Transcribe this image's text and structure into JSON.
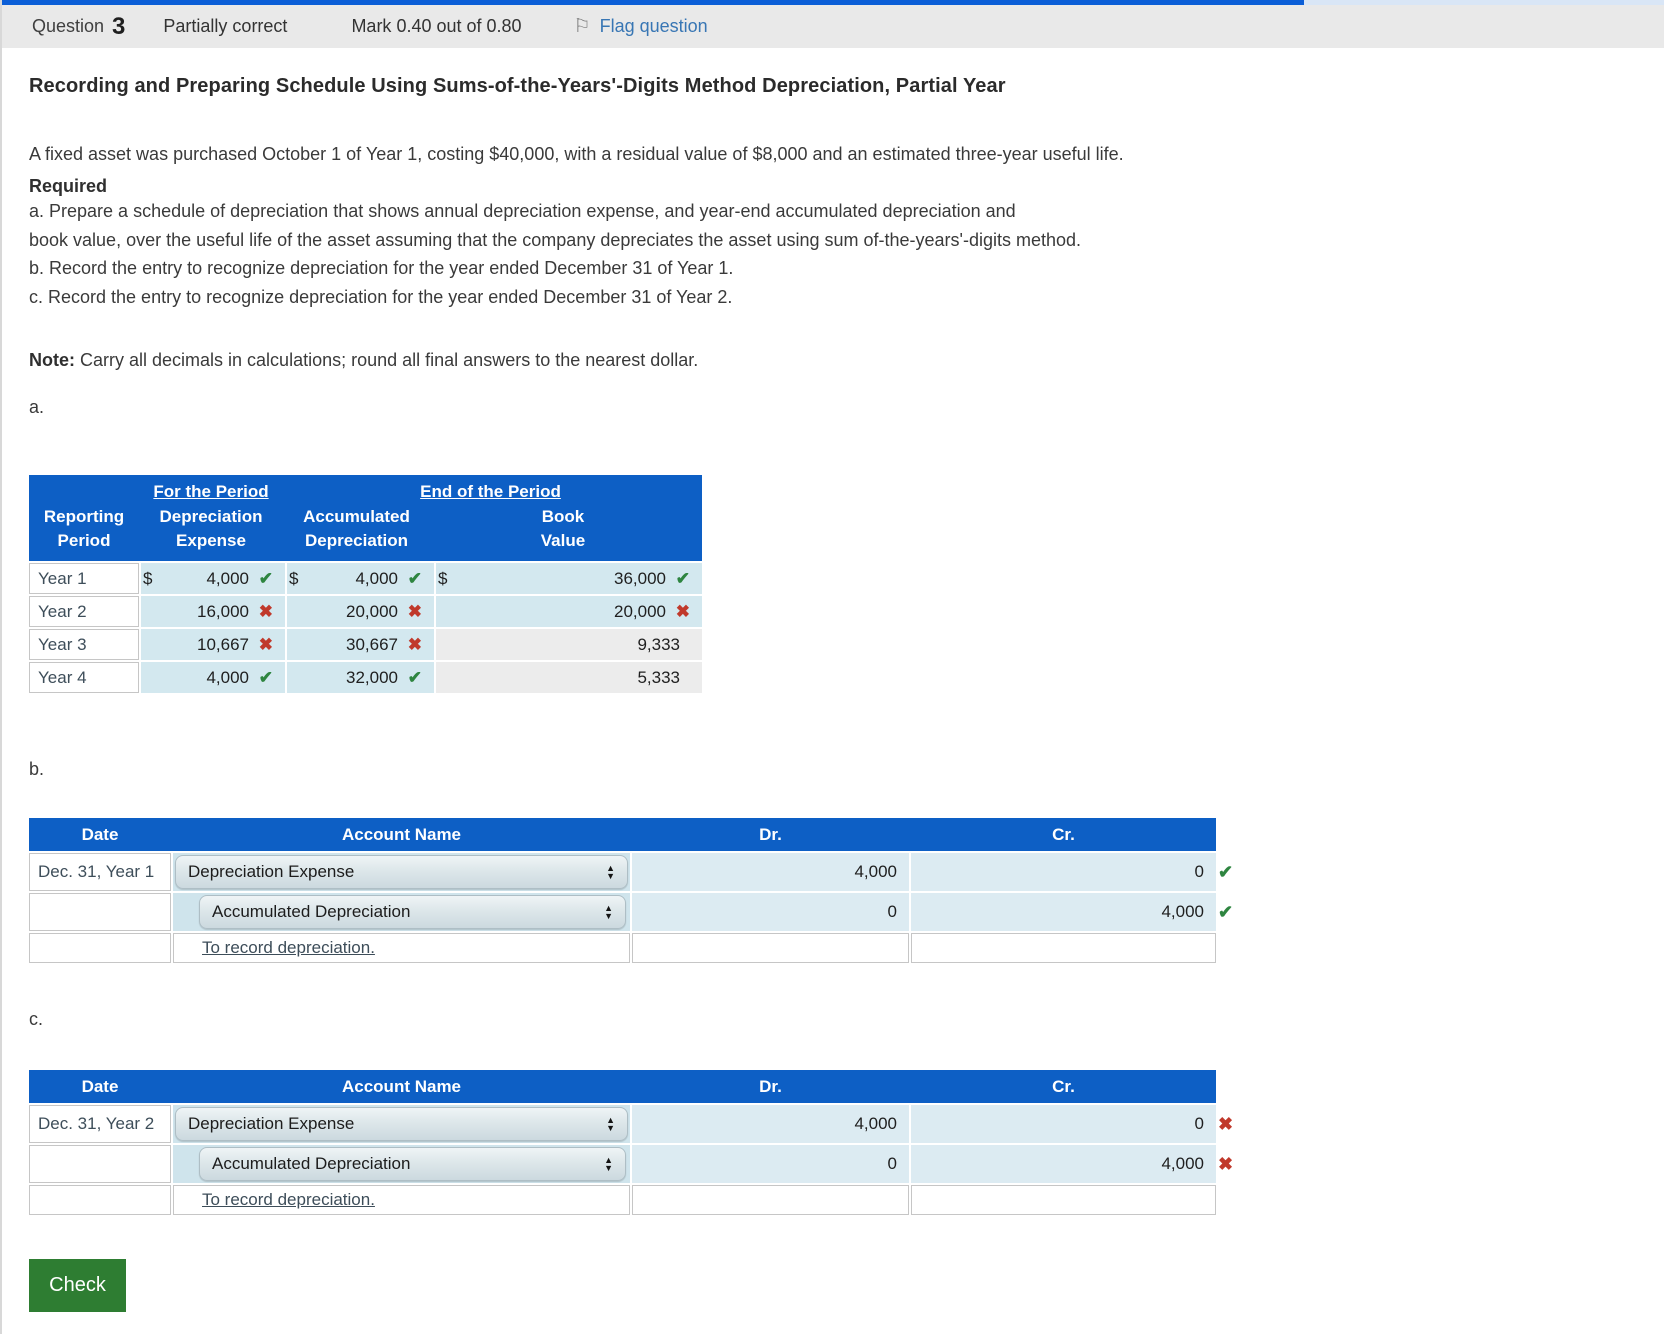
{
  "qbar": {
    "question_label": "Question",
    "question_number": "3",
    "status": "Partially correct",
    "mark": "Mark 0.40 out of 0.80",
    "flag_label": "Flag question"
  },
  "title": "Recording and Preparing Schedule Using Sums-of-the-Years'-Digits Method Depreciation, Partial Year",
  "intro": "A fixed asset was purchased October 1 of Year 1, costing $40,000, with a residual value of $8,000 and an estimated three-year useful life.",
  "required_label": "Required",
  "req_line1": "a. Prepare a schedule of depreciation that shows annual depreciation expense, and year-end accumulated depreciation and",
  "req_line2": "book value, over the useful life of the asset assuming that the company depreciates the asset using sum of-the-years'-digits method.",
  "req_line3": "b. Record the entry to recognize depreciation for the year ended December 31 of Year 1.",
  "req_line4": "c. Record the entry to recognize depreciation for the year ended December 31 of Year 2.",
  "note_label": "Note:",
  "note_text": " Carry all decimals in calculations; round all final answers to the nearest dollar.",
  "sections": {
    "a": "a.",
    "b": "b.",
    "c": "c."
  },
  "schedule": {
    "group1": "For the Period",
    "group2": "End of the Period",
    "h1": [
      "Reporting",
      "Period"
    ],
    "h2": [
      "Depreciation",
      "Expense"
    ],
    "h3": [
      "Accumulated",
      "Depreciation"
    ],
    "h4": [
      "Book",
      "Value"
    ],
    "rows": [
      {
        "period": "Year 1",
        "expense": {
          "cur": "$",
          "val": "4,000",
          "mark": "✔",
          "mark_class": "mark ok",
          "cls": "scell num blue"
        },
        "accum": {
          "cur": "$",
          "val": "4,000",
          "mark": "✔",
          "mark_class": "mark ok",
          "cls": "scell num blue"
        },
        "book": {
          "cur": "$",
          "val": "36,000",
          "mark": "✔",
          "mark_class": "mark ok",
          "cls": "scell num blue"
        }
      },
      {
        "period": "Year 2",
        "expense": {
          "cur": "",
          "val": "16,000",
          "mark": "✖",
          "mark_class": "mark bad",
          "cls": "scell num blue"
        },
        "accum": {
          "cur": "",
          "val": "20,000",
          "mark": "✖",
          "mark_class": "mark bad",
          "cls": "scell num blue"
        },
        "book": {
          "cur": "",
          "val": "20,000",
          "mark": "✖",
          "mark_class": "mark bad",
          "cls": "scell num blue"
        }
      },
      {
        "period": "Year 3",
        "expense": {
          "cur": "",
          "val": "10,667",
          "mark": "✖",
          "mark_class": "mark bad",
          "cls": "scell num blue"
        },
        "accum": {
          "cur": "",
          "val": "30,667",
          "mark": "✖",
          "mark_class": "mark bad",
          "cls": "scell num blue"
        },
        "book": {
          "cur": "",
          "val": "9,333",
          "mark": "",
          "mark_class": "mark none",
          "cls": "scell num gray"
        }
      },
      {
        "period": "Year 4",
        "expense": {
          "cur": "",
          "val": "4,000",
          "mark": "✔",
          "mark_class": "mark ok",
          "cls": "scell num blue"
        },
        "accum": {
          "cur": "",
          "val": "32,000",
          "mark": "✔",
          "mark_class": "mark ok",
          "cls": "scell num blue"
        },
        "book": {
          "cur": "",
          "val": "5,333",
          "mark": "",
          "mark_class": "mark none",
          "cls": "scell num gray"
        }
      }
    ]
  },
  "journal_b": {
    "headers": {
      "date": "Date",
      "account": "Account Name",
      "dr": "Dr.",
      "cr": "Cr."
    },
    "row1": {
      "date": "Dec. 31, Year 1",
      "account": "Depreciation Expense",
      "dr": "4,000",
      "cr": "0",
      "mark": "✔",
      "mark_class": "jmark ok"
    },
    "row2": {
      "account": "Accumulated Depreciation",
      "dr": "0",
      "cr": "4,000",
      "mark": "✔",
      "mark_class": "jmark ok"
    },
    "row3": {
      "memo": "To record depreciation."
    }
  },
  "journal_c": {
    "headers": {
      "date": "Date",
      "account": "Account Name",
      "dr": "Dr.",
      "cr": "Cr."
    },
    "row1": {
      "date": "Dec. 31, Year 2",
      "account": "Depreciation Expense",
      "dr": "4,000",
      "cr": "0",
      "mark": "✖",
      "mark_class": "jmark bad"
    },
    "row2": {
      "account": "Accumulated Depreciation",
      "dr": "0",
      "cr": "4,000",
      "mark": "✖",
      "mark_class": "jmark bad"
    },
    "row3": {
      "memo": "To record depreciation."
    }
  },
  "check_button": "Check",
  "icons": {
    "flag": "⚐",
    "select_up": "▲",
    "select_down": "▼",
    "correct": "✔",
    "incorrect": "✖"
  },
  "colors": {
    "header_blue": "#0d5fc5",
    "cell_blue": "#d3e8ef",
    "journal_cell_blue": "#dcebf2",
    "cell_gray": "#ececec",
    "correct_green": "#2e8540",
    "incorrect_red": "#c0392b",
    "check_button_green": "#2e7d32",
    "flag_link_blue": "#3876b4",
    "top_border_blue": "#0b5ed7",
    "top_border_light": "#d9e6f6",
    "qbar_gray": "#e9e9e9"
  }
}
